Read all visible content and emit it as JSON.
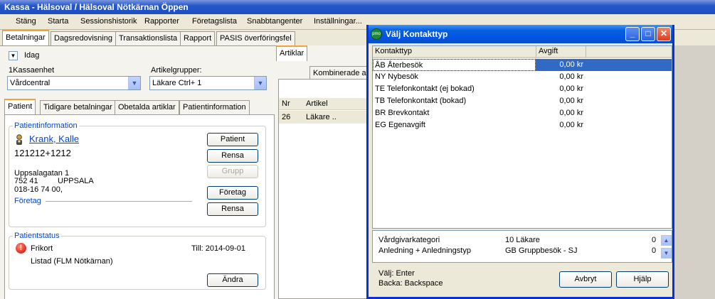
{
  "window": {
    "title": "Kassa - Hälsoval / Hälsoval Nötkärnan Öppen"
  },
  "menu": [
    "Stäng",
    "Starta",
    "Sessionshistorik",
    "Rapporter",
    "Företagslista",
    "Snabbtangenter",
    "Inställningar..."
  ],
  "main_tabs": [
    "Betalningar",
    "Dagsredovisning",
    "Transaktionslista",
    "Rapport",
    "PASIS överföringsfel"
  ],
  "idag_label": "Idag",
  "kassaenhet": {
    "label": "1Kassaenhet",
    "value": "Vårdcentral"
  },
  "artikelgrupper": {
    "label": "Artikelgrupper:",
    "value": "Läkare Ctrl+ 1"
  },
  "patient_tabs": [
    "Patient",
    "Tidigare betalningar",
    "Obetalda artiklar",
    "Patientinformation"
  ],
  "patientinfo": {
    "group_label": "Patientinformation",
    "name": "Krank, Kalle",
    "pnr": "121212+1212",
    "address1": "Uppsalagatan 1",
    "zip": "752 41",
    "city": "UPPSALA",
    "phone": "018-16 74 00,",
    "foretag_label": "Företag",
    "buttons": {
      "patient": "Patient",
      "rensa1": "Rensa",
      "grupp": "Grupp",
      "foretag": "Företag",
      "rensa2": "Rensa"
    }
  },
  "patientstatus": {
    "group_label": "Patientstatus",
    "frikort": "Frikort",
    "till": "Till: 2014-09-01",
    "listad": "Listad (FLM Nötkärnan)",
    "andra": "Ändra"
  },
  "mid": {
    "tabs": [
      "Artiklar",
      "Kombinerade ar"
    ],
    "headers": [
      "Nr",
      "Artikel"
    ],
    "row": {
      "nr": "26",
      "artikel": "Läkare .."
    }
  },
  "dialog": {
    "title": "Välj Kontakttyp",
    "app_icon": "pmo",
    "columns": [
      "Kontakttyp",
      "Avgift"
    ],
    "rows": [
      {
        "typ": "ÅB Återbesök",
        "avgift": "0,00 kr"
      },
      {
        "typ": "NY Nybesök",
        "avgift": "0,00 kr"
      },
      {
        "typ": "TE Telefonkontakt (ej bokad)",
        "avgift": "0,00 kr"
      },
      {
        "typ": "TB Telefonkontakt (bokad)",
        "avgift": "0,00 kr"
      },
      {
        "typ": "BR Brevkontakt",
        "avgift": "0,00 kr"
      },
      {
        "typ": "EG Egenavgift",
        "avgift": "0,00 kr"
      }
    ],
    "info": [
      {
        "label": "Vårdgivarkategori",
        "value": "10 Läkare",
        "num": "0"
      },
      {
        "label": "Anledning + Anledningstyp",
        "value": "GB Gruppbesök - SJ",
        "num": "0"
      }
    ],
    "hint1": "Välj: Enter",
    "hint2": "Backa: Backspace",
    "avbryt": "Avbryt",
    "hjalp": "Hjälp"
  },
  "colors": {
    "title_blue": "#0054e3",
    "selection": "#316ac5",
    "link": "#0046d5"
  }
}
